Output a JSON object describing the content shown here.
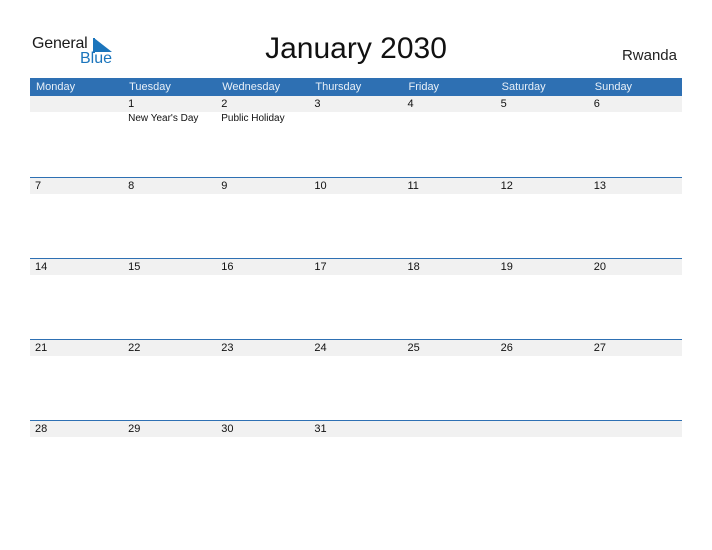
{
  "logo": {
    "line1": "General",
    "line2": "Blue"
  },
  "title": "January 2030",
  "country": "Rwanda",
  "weekdays": [
    "Monday",
    "Tuesday",
    "Wednesday",
    "Thursday",
    "Friday",
    "Saturday",
    "Sunday"
  ],
  "weeks": [
    {
      "days": [
        "",
        "1",
        "2",
        "3",
        "4",
        "5",
        "6"
      ],
      "events": [
        "",
        "New Year's Day",
        "Public Holiday",
        "",
        "",
        "",
        ""
      ]
    },
    {
      "days": [
        "7",
        "8",
        "9",
        "10",
        "11",
        "12",
        "13"
      ],
      "events": [
        "",
        "",
        "",
        "",
        "",
        "",
        ""
      ]
    },
    {
      "days": [
        "14",
        "15",
        "16",
        "17",
        "18",
        "19",
        "20"
      ],
      "events": [
        "",
        "",
        "",
        "",
        "",
        "",
        ""
      ]
    },
    {
      "days": [
        "21",
        "22",
        "23",
        "24",
        "25",
        "26",
        "27"
      ],
      "events": [
        "",
        "",
        "",
        "",
        "",
        "",
        ""
      ]
    },
    {
      "days": [
        "28",
        "29",
        "30",
        "31",
        "",
        "",
        ""
      ],
      "events": [
        "",
        "",
        "",
        "",
        "",
        "",
        ""
      ]
    }
  ],
  "colors": {
    "accent": "#2e70b3",
    "brand_blue": "#1b75bc",
    "date_strip": "#f1f1f1"
  }
}
